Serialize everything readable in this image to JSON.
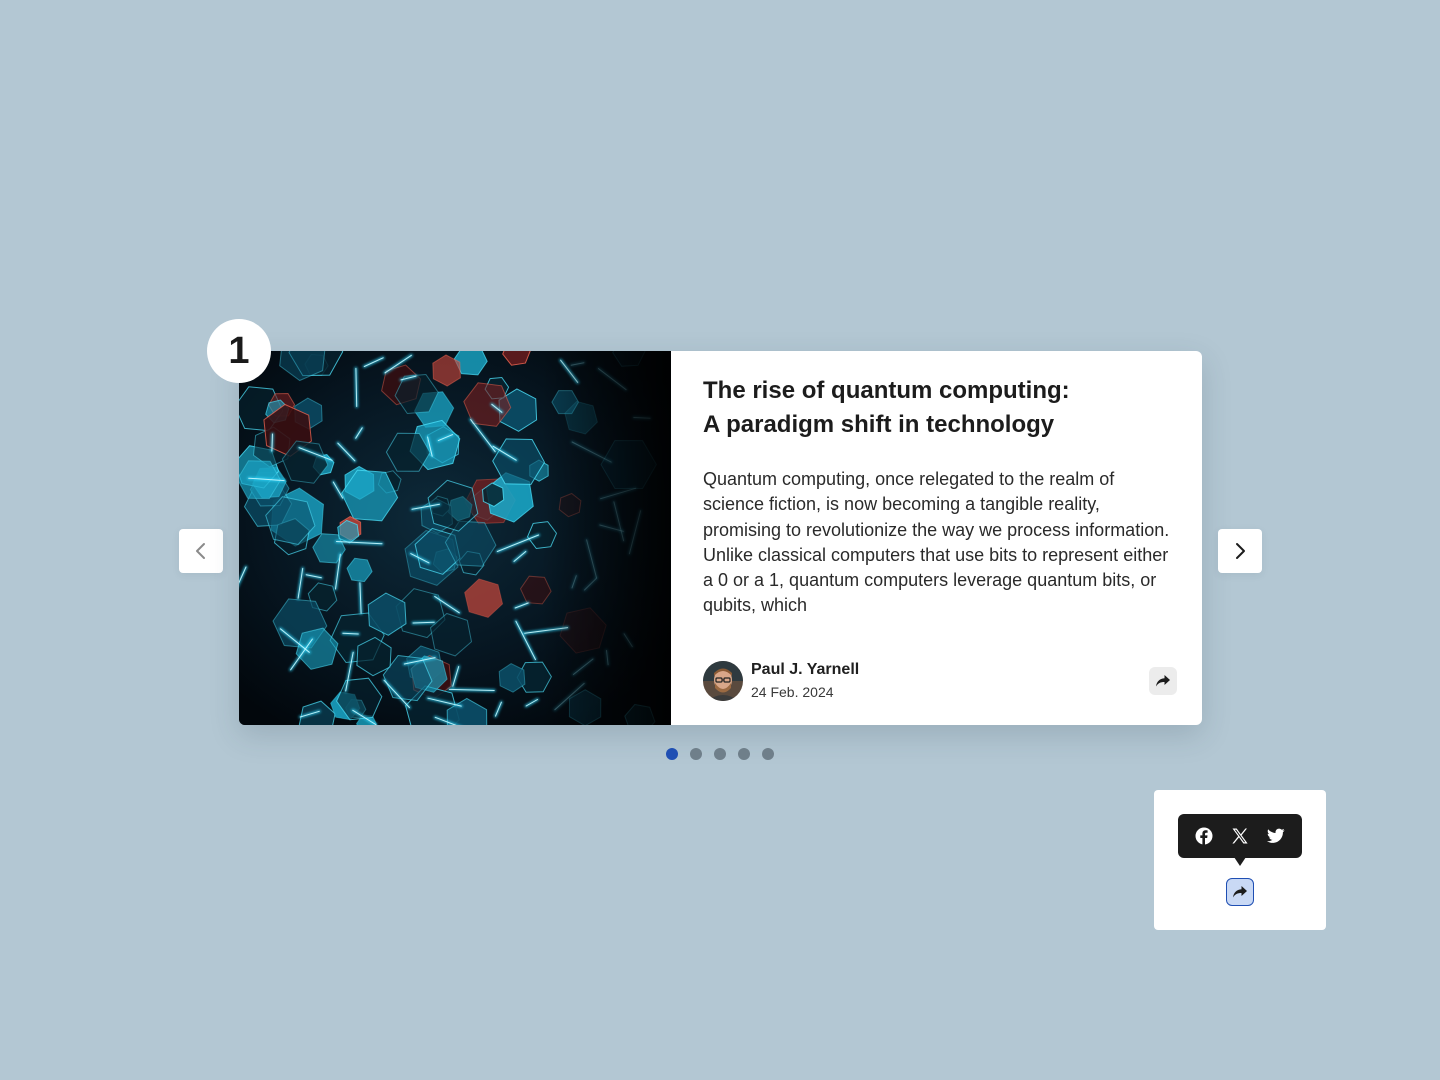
{
  "slide": {
    "number": "1"
  },
  "article": {
    "title_line1": "The rise of quantum computing:",
    "title_line2": "A paradigm shift in technology",
    "excerpt": "Quantum computing, once relegated to the realm of science fiction, is now becoming a tangible reality, promising to revolutionize the way we process information. Unlike classical computers that use bits to represent either a 0 or a 1, quantum computers leverage quantum bits, or qubits, which",
    "author_name": "Paul J. Yarnell",
    "date": "24 Feb. 2024"
  },
  "navigation": {
    "prev_icon": "chevron-left-icon",
    "next_icon": "chevron-right-icon"
  },
  "pagination": {
    "total": 5,
    "active_index": 0
  },
  "share": {
    "icon": "share-arrow-icon",
    "networks": [
      "facebook",
      "x",
      "twitter"
    ]
  },
  "colors": {
    "background": "#b3c7d3",
    "accent": "#1f4fb3",
    "inactive_dot": "#6f7f8a",
    "tooltip": "#1c1c1c"
  }
}
